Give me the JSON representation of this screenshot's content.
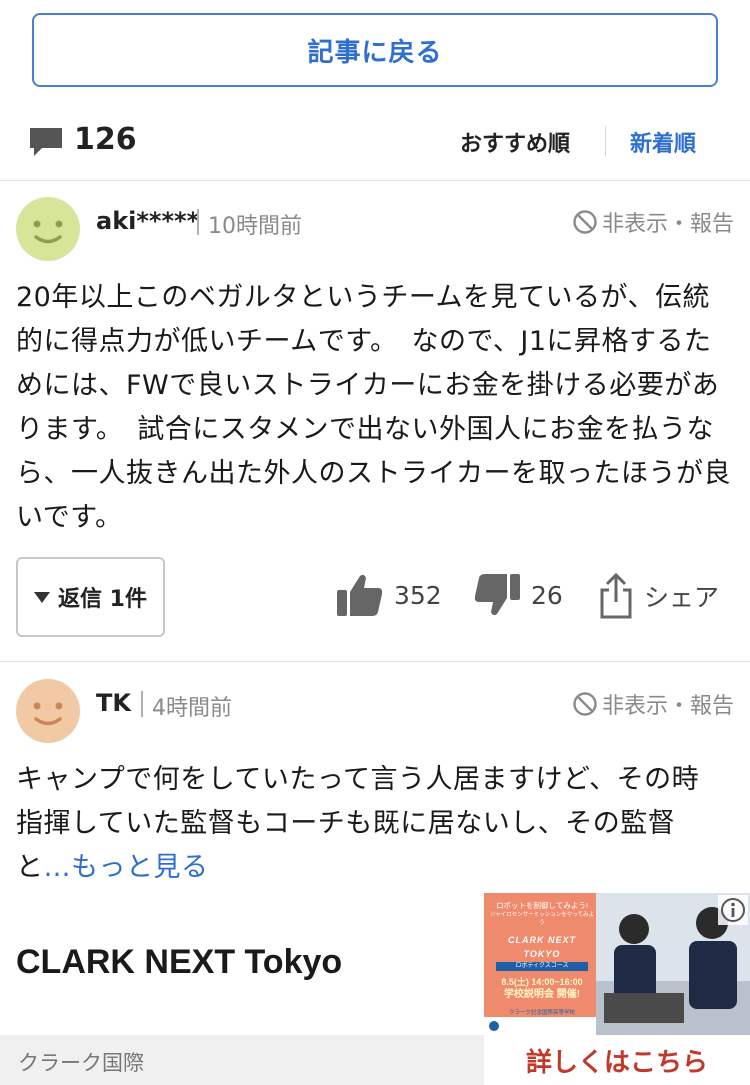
{
  "back_button": {
    "label": "記事に戻る"
  },
  "comments_header": {
    "count": "126",
    "sort_recommended": "おすすめ順",
    "sort_newest": "新着順"
  },
  "comments": [
    {
      "username": "aki*****",
      "time": "10時間前",
      "hide_report": "非表示・報告",
      "text": "20年以上このベガルタというチームを見ているが、伝統的に得点力が低いチームです。　なので、J1に昇格するためには、FWで良いストライカーにお金を掛ける必要があります。　試合にスタメンで出ない外国人にお金を払うなら、一人抜きん出た外人のストライカーを取ったほうが良いです。",
      "reply_label": "返信 1件",
      "likes": "352",
      "dislikes": "26",
      "share_label": "シェア",
      "avatar_color": "#d6e59a"
    },
    {
      "username": "TK",
      "time": "4時間前",
      "hide_report": "非表示・報告",
      "text": "キャンプで何をしていたって言う人居ますけど、その時指揮していた監督もコーチも既に居ないし、その監督と",
      "more_label": "…もっと見る",
      "avatar_color": "#f1c9a5"
    }
  ],
  "ad": {
    "title": "CLARK NEXT Tokyo",
    "source": "クラーク国際",
    "cta": "詳しくはこちら",
    "image_text": {
      "line1": "ロボットを制御してみよう!",
      "line2": "ジャイロセンサーミッションをやってみよう",
      "brand": "CLARK NEXT TOKYO",
      "course": "ロボティクスコース",
      "date": "8.5(土) 14:00~16:00",
      "event": "学校説明会 開催!",
      "school": "クラーク記念国際高等学校"
    }
  },
  "colors": {
    "accent": "#2f6fd0",
    "cta": "#c0392b",
    "ad_orange": "#f08a6c"
  }
}
